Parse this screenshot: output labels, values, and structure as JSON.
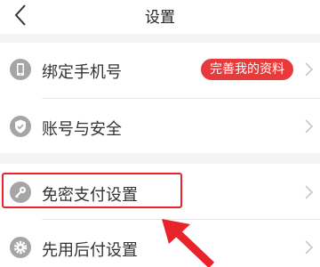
{
  "header": {
    "title": "设置"
  },
  "rows": [
    {
      "label": "绑定手机号",
      "icon": "phone-icon",
      "badge": "完善我的资料"
    },
    {
      "label": "账号与安全",
      "icon": "shield-check-icon"
    },
    {
      "label": "免密支付设置",
      "icon": "key-icon"
    },
    {
      "label": "先用后付设置",
      "icon": "gear-icon"
    }
  ],
  "colors": {
    "badge": "#e83a3a",
    "highlight": "#e8232a",
    "icon": "#a5a5a5"
  }
}
